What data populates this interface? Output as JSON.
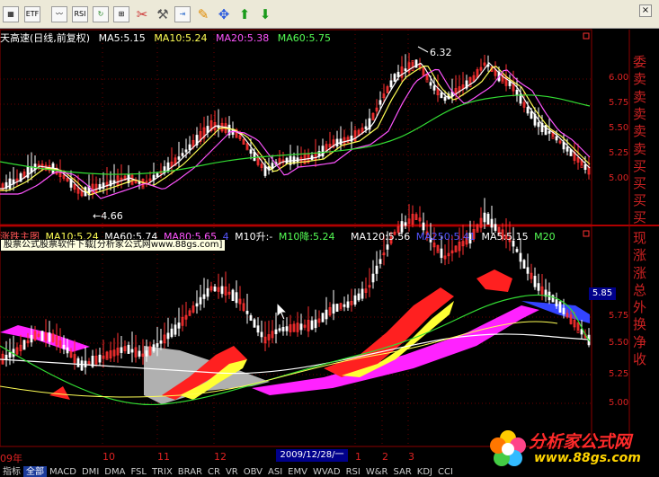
{
  "toolbar": {
    "buttons": [
      {
        "id": "quote",
        "icon": "quote-board-icon",
        "label": ""
      },
      {
        "id": "etf",
        "icon": "etf-icon",
        "label": "ETF"
      },
      {
        "id": "trend",
        "icon": "trend-chart-icon",
        "label": ""
      },
      {
        "id": "rsi",
        "icon": "rsi-icon",
        "label": "RSI"
      },
      {
        "id": "refresh",
        "icon": "refresh-icon",
        "label": ""
      },
      {
        "id": "zoom",
        "icon": "zoom-icon",
        "label": ""
      },
      {
        "id": "tools",
        "icon": "tools-icon",
        "label": ""
      },
      {
        "id": "export",
        "icon": "export-icon",
        "label": ""
      },
      {
        "id": "pen",
        "icon": "pencil-icon",
        "label": ""
      },
      {
        "id": "move",
        "icon": "move-cross-icon",
        "label": ""
      },
      {
        "id": "up",
        "icon": "arrow-up-icon",
        "label": ""
      },
      {
        "id": "down",
        "icon": "arrow-down-icon",
        "label": ""
      }
    ],
    "close_label": "×"
  },
  "top_panel": {
    "stock_name": "天高速(日线,前复权)",
    "ma": [
      {
        "label": "MA5:5.15",
        "color": "#ffffff"
      },
      {
        "label": "MA10:5.24",
        "color": "#ffff55"
      },
      {
        "label": "MA20:5.38",
        "color": "#ff55ff"
      },
      {
        "label": "MA60:5.75",
        "color": "#55ff55"
      }
    ],
    "high_label": "6.32",
    "low_label": "4.66",
    "price_ticks": [
      "6.00",
      "5.75",
      "5.50",
      "5.25",
      "5.00"
    ]
  },
  "bottom_panel": {
    "indicator_segments": [
      {
        "label": "涨跌主图",
        "color": "#ff5555"
      },
      {
        "label": "MA10:5.24",
        "color": "#ffff55"
      },
      {
        "label": "MA60:5.74",
        "color": "#ffffff"
      },
      {
        "label": "MA80:5.65",
        "color": "#ff55ff"
      },
      {
        "label": "4",
        "color": "#5555ff"
      },
      {
        "label": "M10升:-",
        "color": "#ffffff"
      },
      {
        "label": "M10降:5.24",
        "color": "#55ff55"
      },
      {
        "label": "MA120:5.56",
        "color": "#ffffff"
      },
      {
        "label": "MA250:5.41",
        "color": "#5555ff"
      },
      {
        "label": "MA5:5.15",
        "color": "#ffffff"
      },
      {
        "label": "M20",
        "color": "#55ff55"
      }
    ],
    "watermark": "股票公式股票软件下载[分析家公式网www.88gs.com]",
    "current_price": "5.85",
    "price_ticks": [
      "5.75",
      "5.50",
      "5.25",
      "5.00"
    ]
  },
  "right_panel_top": [
    "委",
    "卖",
    "卖",
    "卖",
    "卖",
    "卖",
    "买",
    "买",
    "买",
    "买",
    "买"
  ],
  "right_panel_bot": [
    "现",
    "涨",
    "涨",
    "总",
    "外",
    "换",
    "净",
    "收"
  ],
  "xaxis": {
    "labels": [
      "09年",
      "10",
      "11",
      "12",
      "1",
      "2",
      "3"
    ],
    "date_box": "2009/12/28/一"
  },
  "bottom_tabs": [
    {
      "label": "指标",
      "active": false
    },
    {
      "label": "全部",
      "active": true
    },
    {
      "label": "MACD",
      "active": false
    },
    {
      "label": "DMI",
      "active": false
    },
    {
      "label": "DMA",
      "active": false
    },
    {
      "label": "FSL",
      "active": false
    },
    {
      "label": "TRIX",
      "active": false
    },
    {
      "label": "BRAR",
      "active": false
    },
    {
      "label": "CR",
      "active": false
    },
    {
      "label": "VR",
      "active": false
    },
    {
      "label": "OBV",
      "active": false
    },
    {
      "label": "ASI",
      "active": false
    },
    {
      "label": "EMV",
      "active": false
    },
    {
      "label": "WVAD",
      "active": false
    },
    {
      "label": "RSI",
      "active": false
    },
    {
      "label": "W&R",
      "active": false
    },
    {
      "label": "SAR",
      "active": false
    },
    {
      "label": "KDJ",
      "active": false
    },
    {
      "label": "CCI",
      "active": false
    }
  ],
  "logo": {
    "cn": "分析家公式网",
    "url": "www.88gs.com"
  },
  "colors": {
    "bg": "#000000",
    "grid": "#8b0000",
    "up": "#ff3030",
    "down": "#ffffff",
    "ma5": "#ffffff",
    "ma10": "#ffff55",
    "ma20": "#ff55ff",
    "ma60": "#33dd33"
  }
}
